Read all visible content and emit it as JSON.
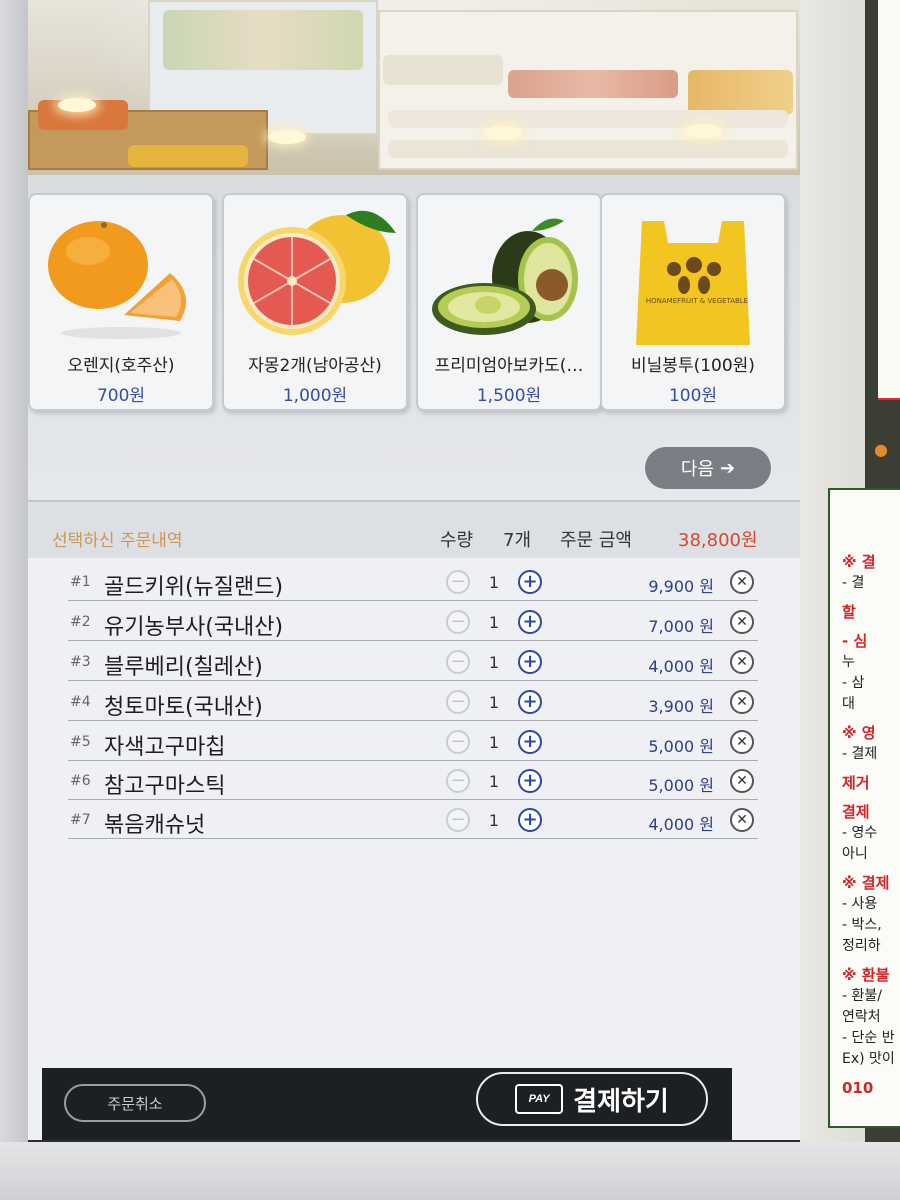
{
  "products": [
    {
      "name": "오렌지(호주산)",
      "price": "700원",
      "icon": "orange-image"
    },
    {
      "name": "자몽2개(남아공산)",
      "price": "1,000원",
      "icon": "grapefruit-image"
    },
    {
      "name": "프리미엄아보카도(…",
      "price": "1,500원",
      "icon": "avocado-image"
    },
    {
      "name": "비닐봉투(100원)",
      "price": "100원",
      "icon": "plastic-bag-image"
    }
  ],
  "bag_label": "HONAMEFRUIT & VEGETABLE",
  "next_button": {
    "label": "다음",
    "icon": "arrow-right-icon"
  },
  "summary": {
    "title": "선택하신 주문내역",
    "qty_label": "수량",
    "qty_total": "7개",
    "amount_label": "주문 금액",
    "amount_total": "38,800원"
  },
  "orders": [
    {
      "no": "#1",
      "name": "골드키위(뉴질랜드)",
      "qty": "1",
      "price": "9,900 원"
    },
    {
      "no": "#2",
      "name": "유기농부사(국내산)",
      "qty": "1",
      "price": "7,000 원"
    },
    {
      "no": "#3",
      "name": "블루베리(칠레산)",
      "qty": "1",
      "price": "4,000 원"
    },
    {
      "no": "#4",
      "name": "청토마토(국내산)",
      "qty": "1",
      "price": "3,900 원"
    },
    {
      "no": "#5",
      "name": "자색고구마칩",
      "qty": "1",
      "price": "5,000 원"
    },
    {
      "no": "#6",
      "name": "참고구마스틱",
      "qty": "1",
      "price": "5,000 원"
    },
    {
      "no": "#7",
      "name": "볶음캐슈넛",
      "qty": "1",
      "price": "4,000 원"
    }
  ],
  "bottom": {
    "cancel_label": "주문취소",
    "pay_label": "결제하기",
    "pay_icon_text": "PAY"
  },
  "notice_lines": [
    {
      "text": "※ 결",
      "style": "red"
    },
    {
      "text": "- 결",
      "style": ""
    },
    {
      "text": "  할",
      "style": "red"
    },
    {
      "text": "- 심",
      "style": "red"
    },
    {
      "text": "  누",
      "style": ""
    },
    {
      "text": "- 삼",
      "style": ""
    },
    {
      "text": "  대",
      "style": ""
    },
    {
      "text": "※ 영",
      "style": "red"
    },
    {
      "text": "- 결제",
      "style": ""
    },
    {
      "text": "  제거",
      "style": "red"
    },
    {
      "text": "  결제",
      "style": "red"
    },
    {
      "text": "- 영수",
      "style": ""
    },
    {
      "text": "  아니",
      "style": ""
    },
    {
      "text": "※ 결제",
      "style": "red"
    },
    {
      "text": "- 사용",
      "style": ""
    },
    {
      "text": "- 박스,",
      "style": ""
    },
    {
      "text": "  정리하",
      "style": ""
    },
    {
      "text": "※ 환불",
      "style": "red"
    },
    {
      "text": "- 환불/",
      "style": ""
    },
    {
      "text": "  연락처",
      "style": ""
    },
    {
      "text": "- 단순 반",
      "style": ""
    },
    {
      "text": "  Ex) 맛이",
      "style": ""
    },
    {
      "text": "010",
      "style": "red"
    }
  ]
}
